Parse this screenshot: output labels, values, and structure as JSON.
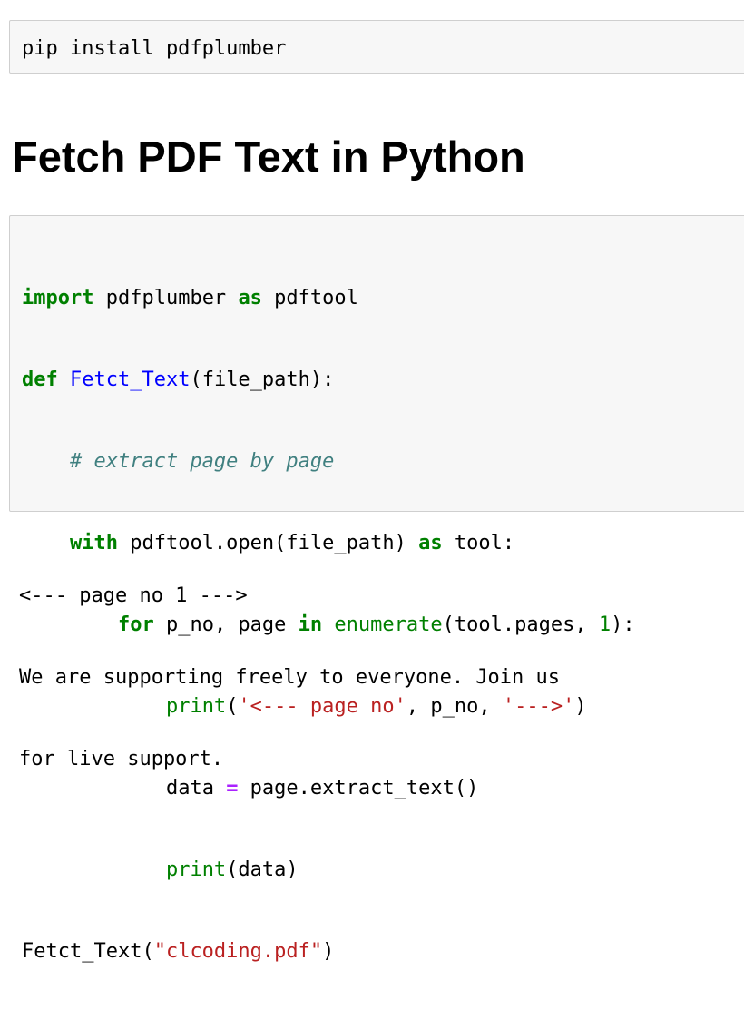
{
  "pip_cell": {
    "code": "pip install pdfplumber"
  },
  "heading": "Fetch PDF Text in Python",
  "code_cell": {
    "l1": {
      "kw1": "import",
      "t1": " pdfplumber ",
      "kw2": "as",
      "t2": " pdftool"
    },
    "l2": {
      "kw": "def",
      "sp": " ",
      "fn": "Fetct_Text",
      "rest": "(file_path):"
    },
    "l3": {
      "indent": "    ",
      "comment": "# extract page by page"
    },
    "l4": {
      "indent": "    ",
      "kw1": "with",
      "t1": " pdftool.open(file_path) ",
      "kw2": "as",
      "t2": " tool:"
    },
    "l5": {
      "indent": "        ",
      "kw1": "for",
      "t1": " p_no, page ",
      "kw2": "in",
      "sp": " ",
      "bi": "enumerate",
      "t2": "(tool.pages, ",
      "num": "1",
      "t3": "):"
    },
    "l6": {
      "indent": "            ",
      "bi": "print",
      "p1": "(",
      "s1": "'<--- page no'",
      "p2": ", p_no, ",
      "s2": "'--->'",
      "p3": ")"
    },
    "l7": {
      "indent": "            ",
      "t1": "data ",
      "op": "=",
      "t2": " page.extract_text()"
    },
    "l8": {
      "indent": "            ",
      "bi": "print",
      "rest": "(data)"
    },
    "l9": {
      "fn": "Fetct_Text",
      "p1": "(",
      "str": "\"clcoding.pdf\"",
      "p2": ")"
    }
  },
  "output": {
    "lines": [
      "<--- page no 1 --->",
      "We are supporting freely to everyone. Join us",
      "for live support."
    ]
  },
  "colors": {
    "keyword": "#008000",
    "function_name": "#0000ff",
    "comment": "#408080",
    "operator": "#aa22ff",
    "string": "#ba2121",
    "builtin": "#008000",
    "number": "#008000",
    "cell_background": "#f7f7f7",
    "cell_border": "#cfcfcf"
  }
}
